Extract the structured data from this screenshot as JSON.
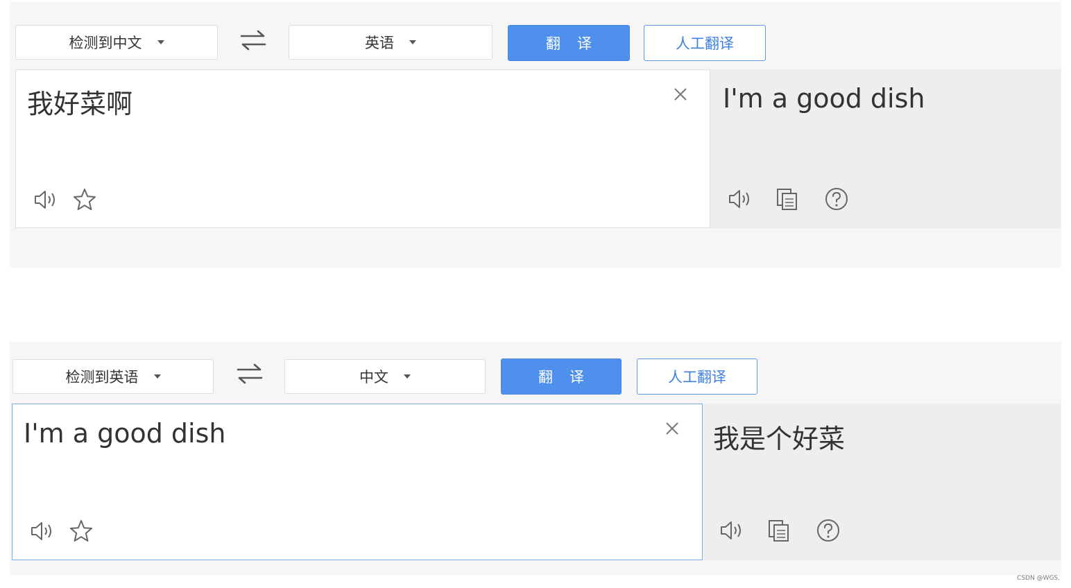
{
  "panels": [
    {
      "source_lang": "检测到中文",
      "target_lang": "英语",
      "translate_label": "翻译",
      "human_label": "人工翻译",
      "input_text": "我好菜啊",
      "output_text": "I'm a good dish",
      "input_focused": false
    },
    {
      "source_lang": "检测到英语",
      "target_lang": "中文",
      "translate_label": "翻译",
      "human_label": "人工翻译",
      "input_text": "I'm a good dish",
      "output_text": "我是个好菜",
      "input_focused": true
    }
  ],
  "icons": {
    "swap": "swap-arrows-icon",
    "close": "close-icon",
    "speaker": "speaker-icon",
    "star": "star-icon",
    "copy": "copy-icon",
    "help": "help-icon"
  },
  "colors": {
    "accent": "#4f90ec",
    "panel_bg": "#f6f6f6",
    "output_bg": "#eeeeee",
    "focus_border": "#7aa9ec"
  },
  "watermark": "CSDN @WGS."
}
